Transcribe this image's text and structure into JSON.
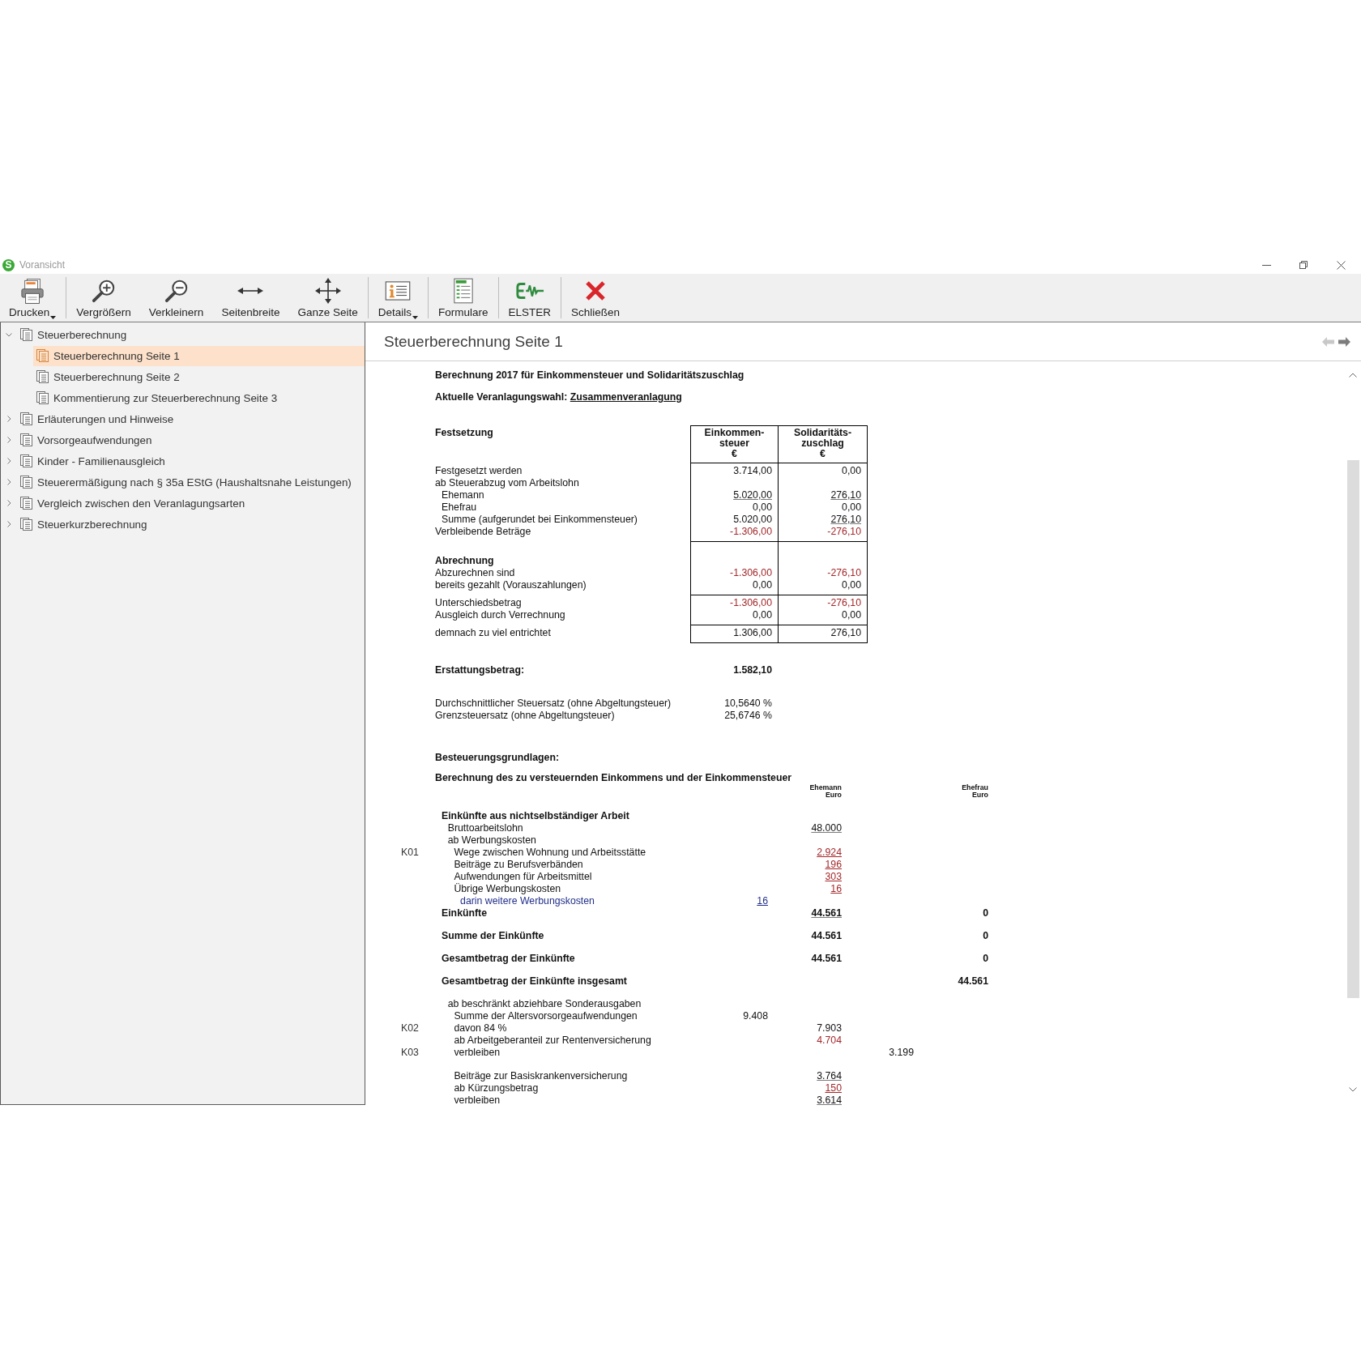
{
  "window": {
    "logo": "S",
    "title": "Voransicht"
  },
  "toolbar": {
    "groups": [
      [
        {
          "label": "Drucken",
          "kind": "print",
          "dropdown": true
        }
      ],
      [
        {
          "label": "Vergrößern",
          "kind": "zoom-in",
          "dropdown": false
        },
        {
          "label": "Verkleinern",
          "kind": "zoom-out",
          "dropdown": false
        },
        {
          "label": "Seitenbreite",
          "kind": "page-width",
          "dropdown": false
        },
        {
          "label": "Ganze Seite",
          "kind": "whole-page",
          "dropdown": false
        }
      ],
      [
        {
          "label": "Details",
          "kind": "details",
          "dropdown": true
        }
      ],
      [
        {
          "label": "Formulare",
          "kind": "forms",
          "dropdown": false
        }
      ],
      [
        {
          "label": "ELSTER",
          "kind": "elster",
          "dropdown": false
        }
      ],
      [
        {
          "label": "Schließen",
          "kind": "close",
          "dropdown": false
        }
      ]
    ]
  },
  "sidebar": {
    "items": [
      {
        "label": "Steuerberechnung",
        "expanded": true,
        "selected": false,
        "children": [
          {
            "label": "Steuerberechnung Seite 1",
            "selected": true
          },
          {
            "label": "Steuerberechnung Seite 2",
            "selected": false
          },
          {
            "label": "Kommentierung zur Steuerberechnung Seite 3",
            "selected": false
          }
        ]
      },
      {
        "label": "Erläuterungen und Hinweise",
        "expanded": false,
        "selected": false
      },
      {
        "label": "Vorsorgeaufwendungen",
        "expanded": false,
        "selected": false
      },
      {
        "label": "Kinder - Familienausgleich",
        "expanded": false,
        "selected": false
      },
      {
        "label": "Steuerermäßigung nach § 35a EStG (Haushaltsnahe Leistungen)",
        "expanded": false,
        "selected": false
      },
      {
        "label": "Vergleich zwischen den Veranlagungsarten",
        "expanded": false,
        "selected": false
      },
      {
        "label": "Steuerkurzberechnung",
        "expanded": false,
        "selected": false
      }
    ]
  },
  "viewer": {
    "title": "Steuerberechnung Seite 1",
    "nav": {
      "back": {
        "disabled": true
      },
      "forward": {
        "disabled": false
      }
    },
    "document": {
      "heading": "Berechnung 2017 für Einkommensteuer und Solidaritätszuschlag",
      "assessment_choice": {
        "label": "Aktuelle Veranlagungswahl:",
        "value": "Zusammenveranlagung"
      },
      "assessment": {
        "title": "Festsetzung",
        "columns": [
          {
            "lines": [
              "Einkommen-",
              "steuer"
            ],
            "unit": "€"
          },
          {
            "lines": [
              "Solidaritäts-",
              "zuschlag"
            ],
            "unit": "€"
          }
        ],
        "sections": [
          {
            "rows": [
              {
                "label": "Festgesetzt werden",
                "kind": "item",
                "values": [
                  {
                    "text": "3.714,00",
                    "underlined": false,
                    "deducted": false
                  },
                  {
                    "text": "0,00",
                    "underlined": false,
                    "deducted": false
                  }
                ]
              },
              {
                "label": "ab Steuerabzug vom Arbeitslohn",
                "kind": "item",
                "children": [
                  {
                    "label": "Ehemann",
                    "kind": "item",
                    "values": [
                      {
                        "text": "5.020,00",
                        "underlined": true,
                        "deducted": false
                      },
                      {
                        "text": "276,10",
                        "underlined": true,
                        "deducted": false
                      }
                    ]
                  },
                  {
                    "label": "Ehefrau",
                    "kind": "item",
                    "values": [
                      {
                        "text": "0,00",
                        "underlined": false,
                        "deducted": false
                      },
                      {
                        "text": "0,00",
                        "underlined": false,
                        "deducted": false
                      }
                    ]
                  },
                  {
                    "label": "Summe (aufgerundet bei Einkommensteuer)",
                    "kind": "item",
                    "values": [
                      {
                        "text": "5.020,00",
                        "underlined": false,
                        "deducted": false
                      },
                      {
                        "text": "276,10",
                        "underlined": true,
                        "deducted": false
                      }
                    ]
                  }
                ]
              },
              {
                "label": "Verbleibende Beträge",
                "kind": "item",
                "values": [
                  {
                    "text": "-1.306,00",
                    "underlined": false,
                    "deducted": true
                  },
                  {
                    "text": "-276,10",
                    "underlined": false,
                    "deducted": true
                  }
                ]
              }
            ]
          },
          {
            "rows": [
              {
                "label": "Abrechnung",
                "kind": "heading"
              },
              {
                "label": "Abzurechnen sind",
                "kind": "item",
                "values": [
                  {
                    "text": "-1.306,00",
                    "underlined": false,
                    "deducted": true
                  },
                  {
                    "text": "-276,10",
                    "underlined": false,
                    "deducted": true
                  }
                ]
              },
              {
                "label": "bereits gezahlt (Vorauszahlungen)",
                "kind": "item",
                "values": [
                  {
                    "text": "0,00",
                    "underlined": false,
                    "deducted": false
                  },
                  {
                    "text": "0,00",
                    "underlined": false,
                    "deducted": false
                  }
                ]
              }
            ]
          },
          {
            "rows": [
              {
                "label": "Unterschiedsbetrag",
                "kind": "item",
                "values": [
                  {
                    "text": "-1.306,00",
                    "underlined": false,
                    "deducted": true
                  },
                  {
                    "text": "-276,10",
                    "underlined": false,
                    "deducted": true
                  }
                ]
              },
              {
                "label": "Ausgleich durch Verrechnung",
                "kind": "item",
                "values": [
                  {
                    "text": "0,00",
                    "underlined": false,
                    "deducted": false
                  },
                  {
                    "text": "0,00",
                    "underlined": false,
                    "deducted": false
                  }
                ]
              }
            ]
          },
          {
            "rows": [
              {
                "label": "demnach zu viel entrichtet",
                "kind": "item",
                "values": [
                  {
                    "text": "1.306,00",
                    "underlined": false,
                    "deducted": false
                  },
                  {
                    "text": "276,10",
                    "underlined": false,
                    "deducted": false
                  }
                ]
              }
            ]
          }
        ]
      },
      "refund": {
        "label": "Erstattungsbetrag:",
        "value": "1.582,10"
      },
      "rates": [
        {
          "label": "Durchschnittlicher Steuersatz (ohne Abgeltungsteuer)",
          "value": "10,5640 %"
        },
        {
          "label": "Grenzsteuersatz (ohne Abgeltungsteuer)",
          "value": "25,6746 %"
        }
      ],
      "basis_heading": "Besteuerungsgrundlagen:",
      "income": {
        "title": "Berechnung des zu versteuernden Einkommens und der Einkommensteuer",
        "headings": {
          "ehemann": {
            "name": "Ehemann",
            "unit": "Euro"
          },
          "ehefrau": {
            "name": "Ehefrau",
            "unit": "Euro"
          }
        },
        "rows": [
          {
            "label": "Einkünfte aus nichtselbständiger Arbeit",
            "kind": "heading",
            "children": [
              {
                "label": "Bruttoarbeitslohn",
                "kind": "item",
                "ehemann": {
                  "text": "48.000",
                  "underlined": true,
                  "deducted": false
                }
              },
              {
                "label": "ab Werbungskosten",
                "kind": "item",
                "children": [
                  {
                    "code": "K01",
                    "label": "Wege zwischen Wohnung und Arbeitsstätte",
                    "kind": "item",
                    "ehemann": {
                      "text": "2.924",
                      "underlined": true,
                      "deducted": true
                    }
                  },
                  {
                    "label": "Beiträge zu Berufsverbänden",
                    "kind": "item",
                    "ehemann": {
                      "text": "196",
                      "underlined": true,
                      "deducted": true
                    }
                  },
                  {
                    "label": "Aufwendungen für Arbeitsmittel",
                    "kind": "item",
                    "ehemann": {
                      "text": "303",
                      "underlined": true,
                      "deducted": true
                    }
                  },
                  {
                    "label": "Übrige Werbungskosten",
                    "kind": "item",
                    "ehemann": {
                      "text": "16",
                      "underlined": true,
                      "deducted": true
                    },
                    "children": [
                      {
                        "label": "darin weitere Werbungskosten",
                        "kind": "note",
                        "column_1": {
                          "text": "16",
                          "underlined": true,
                          "deducted": false
                        }
                      }
                    ]
                  }
                ]
              }
            ]
          },
          {
            "label": "Einkünfte",
            "kind": "total",
            "ehemann": {
              "text": "44.561",
              "underlined": true,
              "deducted": false
            },
            "ehefrau": {
              "text": "0",
              "underlined": false,
              "deducted": false
            }
          },
          {
            "label": "Summe der Einkünfte",
            "kind": "total",
            "ehemann": {
              "text": "44.561",
              "underlined": false,
              "deducted": false
            },
            "ehefrau": {
              "text": "0",
              "underlined": false,
              "deducted": false
            }
          },
          {
            "label": "Gesamtbetrag der Einkünfte",
            "kind": "total",
            "ehemann": {
              "text": "44.561",
              "underlined": false,
              "deducted": false
            },
            "ehefrau": {
              "text": "0",
              "underlined": false,
              "deducted": false
            }
          },
          {
            "label": "Gesamtbetrag der Einkünfte insgesamt",
            "kind": "total",
            "ehefrau": {
              "text": "44.561",
              "underlined": false,
              "deducted": false
            },
            "children": [
              {
                "label": "ab beschränkt abziehbare Sonderausgaben",
                "kind": "item",
                "children": [
                  {
                    "label": "Summe der Altersvorsorgeaufwendungen",
                    "kind": "item",
                    "column_1": {
                      "text": "9.408",
                      "underlined": false,
                      "deducted": false
                    }
                  },
                  {
                    "code": "K02",
                    "label": "davon 84 %",
                    "kind": "item",
                    "ehemann": {
                      "text": "7.903",
                      "underlined": false,
                      "deducted": false
                    }
                  },
                  {
                    "label": "ab Arbeitgeberanteil zur Rentenversicherung",
                    "kind": "item",
                    "ehemann": {
                      "text": "4.704",
                      "underlined": false,
                      "deducted": true
                    }
                  },
                  {
                    "code": "K03",
                    "label": "verbleiben",
                    "kind": "result",
                    "column_3": {
                      "text": "3.199",
                      "underlined": false,
                      "deducted": false
                    }
                  },
                  {
                    "label": "Beiträge zur Basiskrankenversicherung",
                    "kind": "item",
                    "ehemann": {
                      "text": "3.764",
                      "underlined": true,
                      "deducted": false
                    }
                  },
                  {
                    "label": "ab Kürzungsbetrag",
                    "kind": "item",
                    "ehemann": {
                      "text": "150",
                      "underlined": true,
                      "deducted": true
                    }
                  },
                  {
                    "label": "verbleiben",
                    "kind": "result",
                    "ehemann": {
                      "text": "3.614",
                      "underlined": true,
                      "deducted": false
                    }
                  }
                ]
              }
            ]
          }
        ]
      }
    }
  }
}
